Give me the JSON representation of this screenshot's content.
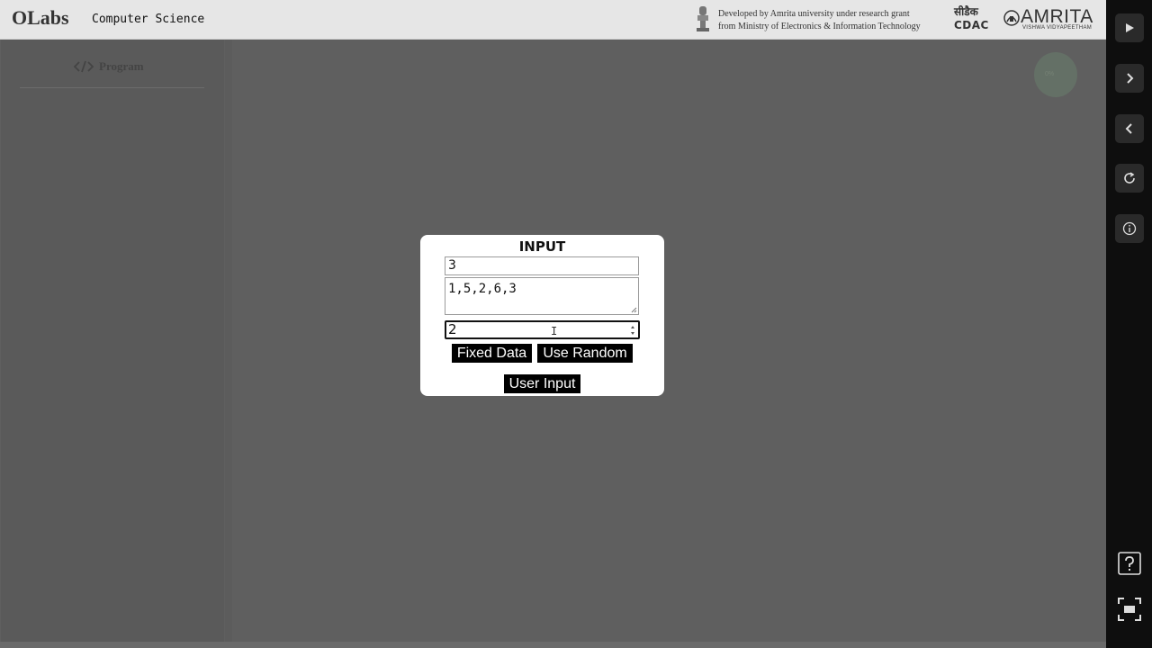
{
  "header": {
    "brand": "OLabs",
    "subject": "Computer Science",
    "dev_line1": "Developed by Amrita university under research grant",
    "dev_line2": "from Ministry of Electronics & Information Technology",
    "cdac_hindi": "सीडैक",
    "cdac_latin": "CDAC",
    "amrita_name": "AMRITA",
    "amrita_sub": "VISHWA VIDYAPEETHAM"
  },
  "left_panel": {
    "tab_label": "Program"
  },
  "progress_text": "0%",
  "modal": {
    "title": "INPUT",
    "size_value": "3",
    "array_value": "1,5,2,6,3",
    "key_value": "2",
    "fixed_label": "Fixed Data",
    "random_label": "Use Random",
    "user_label": "User Input"
  },
  "rail_icons": [
    "play-icon",
    "next-icon",
    "previous-icon",
    "reload-icon",
    "info-icon",
    "help-icon",
    "fullscreen-icon"
  ],
  "colors": {
    "rail_bg": "#0e0e0e",
    "overlay_bg": "#5f5f5f",
    "header_bg": "#e6e6e6"
  }
}
